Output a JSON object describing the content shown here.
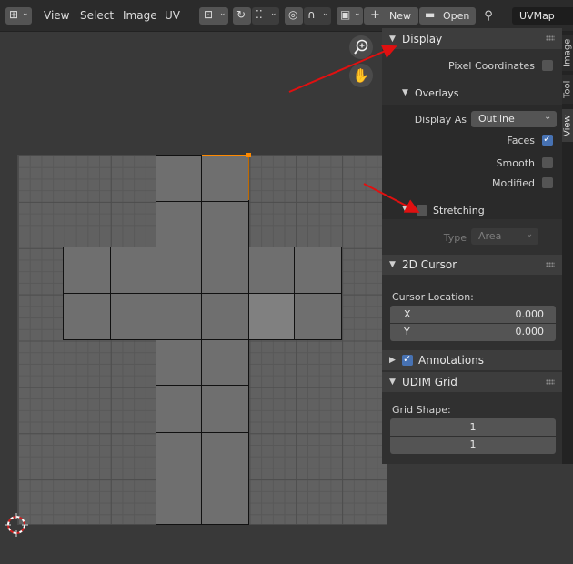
{
  "header": {
    "menus": [
      "View",
      "Select",
      "Image",
      "UV"
    ],
    "new_label": "New",
    "open_label": "Open",
    "uvmap_value": "UVMap"
  },
  "sidebar": {
    "display": {
      "title": "Display",
      "pixel_coordinates_label": "Pixel Coordinates",
      "pixel_coordinates_checked": false,
      "overlays": {
        "title": "Overlays",
        "display_as_label": "Display As",
        "display_as_value": "Outline",
        "faces_label": "Faces",
        "faces_checked": true,
        "smooth_label": "Smooth",
        "smooth_checked": false,
        "modified_label": "Modified",
        "modified_checked": false
      },
      "stretching": {
        "title": "Stretching",
        "checked": false,
        "type_label": "Type",
        "type_value": "Area"
      }
    },
    "cursor": {
      "title": "2D Cursor",
      "location_label": "Cursor Location:",
      "x_label": "X",
      "x_value": "0.000",
      "y_label": "Y",
      "y_value": "0.000"
    },
    "annotations": {
      "title": "Annotations",
      "checked": true
    },
    "udim": {
      "title": "UDIM Grid",
      "grid_shape_label": "Grid Shape:",
      "grid_x": "1",
      "grid_y": "1"
    }
  },
  "tabs": [
    "Image",
    "Tool",
    "View"
  ],
  "colors": {
    "accent": "#4772b3",
    "annotation_arrow": "#e01010",
    "selected_vertex": "#ff8a00"
  }
}
